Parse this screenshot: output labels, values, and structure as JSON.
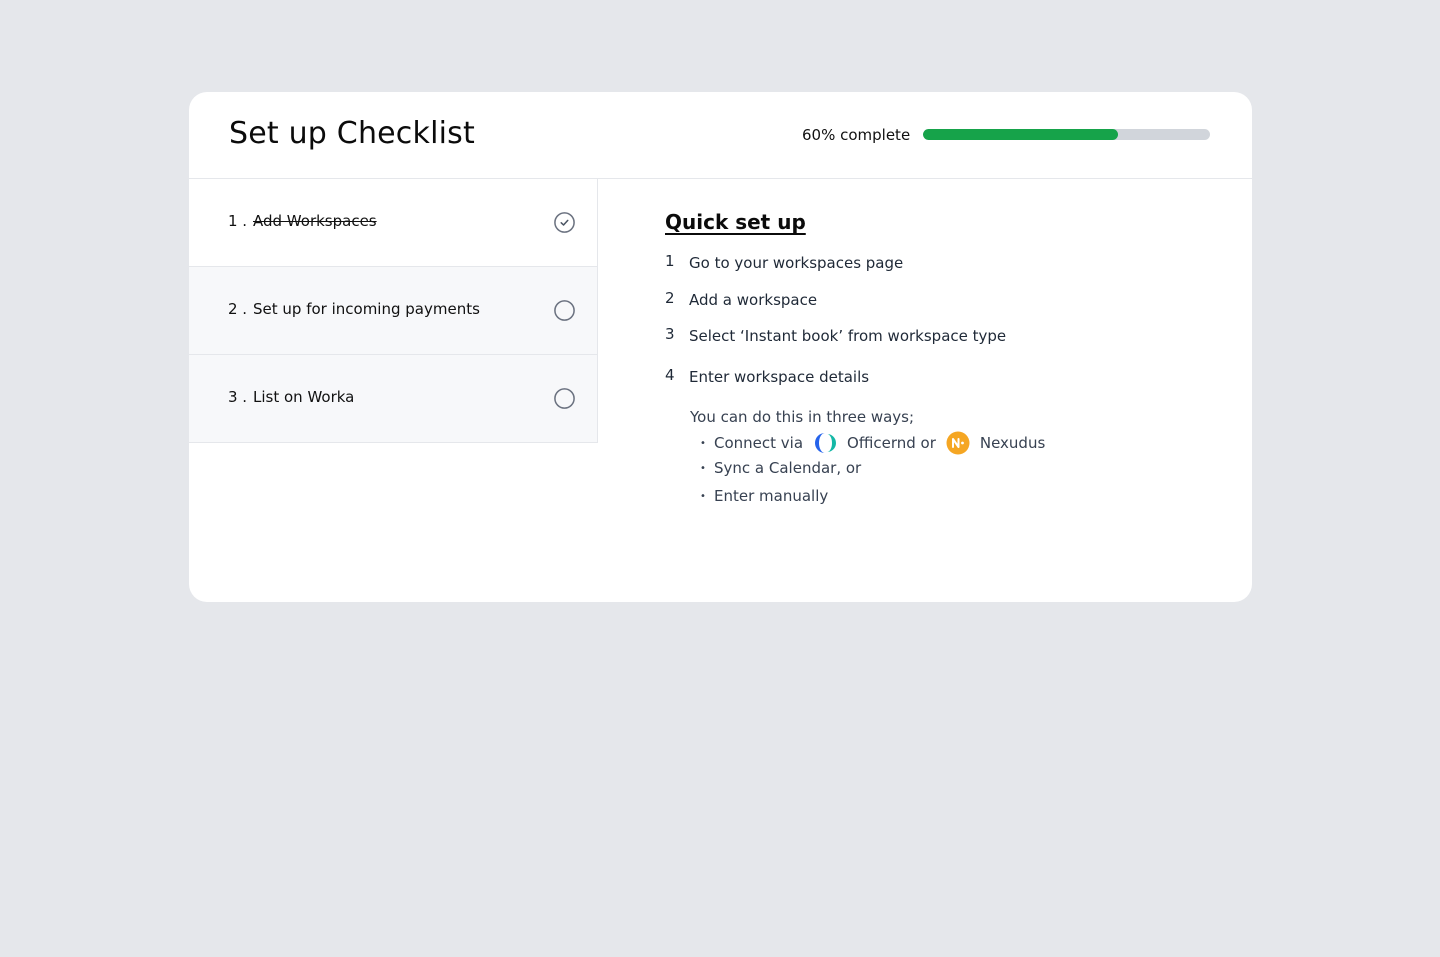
{
  "card": {
    "title": "Set up Checklist",
    "progress_label": "60% complete",
    "progress_fraction": 0.68,
    "colors": {
      "progress": "#16a34a",
      "track": "#d1d5db"
    }
  },
  "steps": [
    {
      "num": "1 .",
      "label": "Add Workspaces",
      "status": "done",
      "icon": "check-circle-icon"
    },
    {
      "num": "2 .",
      "label": "Set up for incoming payments",
      "status": "pending",
      "icon": "empty-circle-icon"
    },
    {
      "num": "3 .",
      "label": "List on Worka",
      "status": "pending",
      "icon": "empty-circle-icon"
    }
  ],
  "detail": {
    "title": "Quick set up",
    "instructions": [
      {
        "num": "1",
        "text": "Go to your workspaces page"
      },
      {
        "num": "2",
        "text": "Add a workspace"
      },
      {
        "num": "3",
        "text": "Select ‘Instant book’ from workspace type"
      },
      {
        "num": "4",
        "text": "Enter workspace details"
      }
    ],
    "ways_intro": "You can do this in three ways;",
    "ways": {
      "connect_prefix": "Connect via",
      "officernd": "Officernd or",
      "nexudus": "Nexudus",
      "sync": "Sync a Calendar, or",
      "manual": "Enter manually"
    },
    "logos": [
      "officernd-logo-icon",
      "nexudus-logo-icon"
    ]
  }
}
